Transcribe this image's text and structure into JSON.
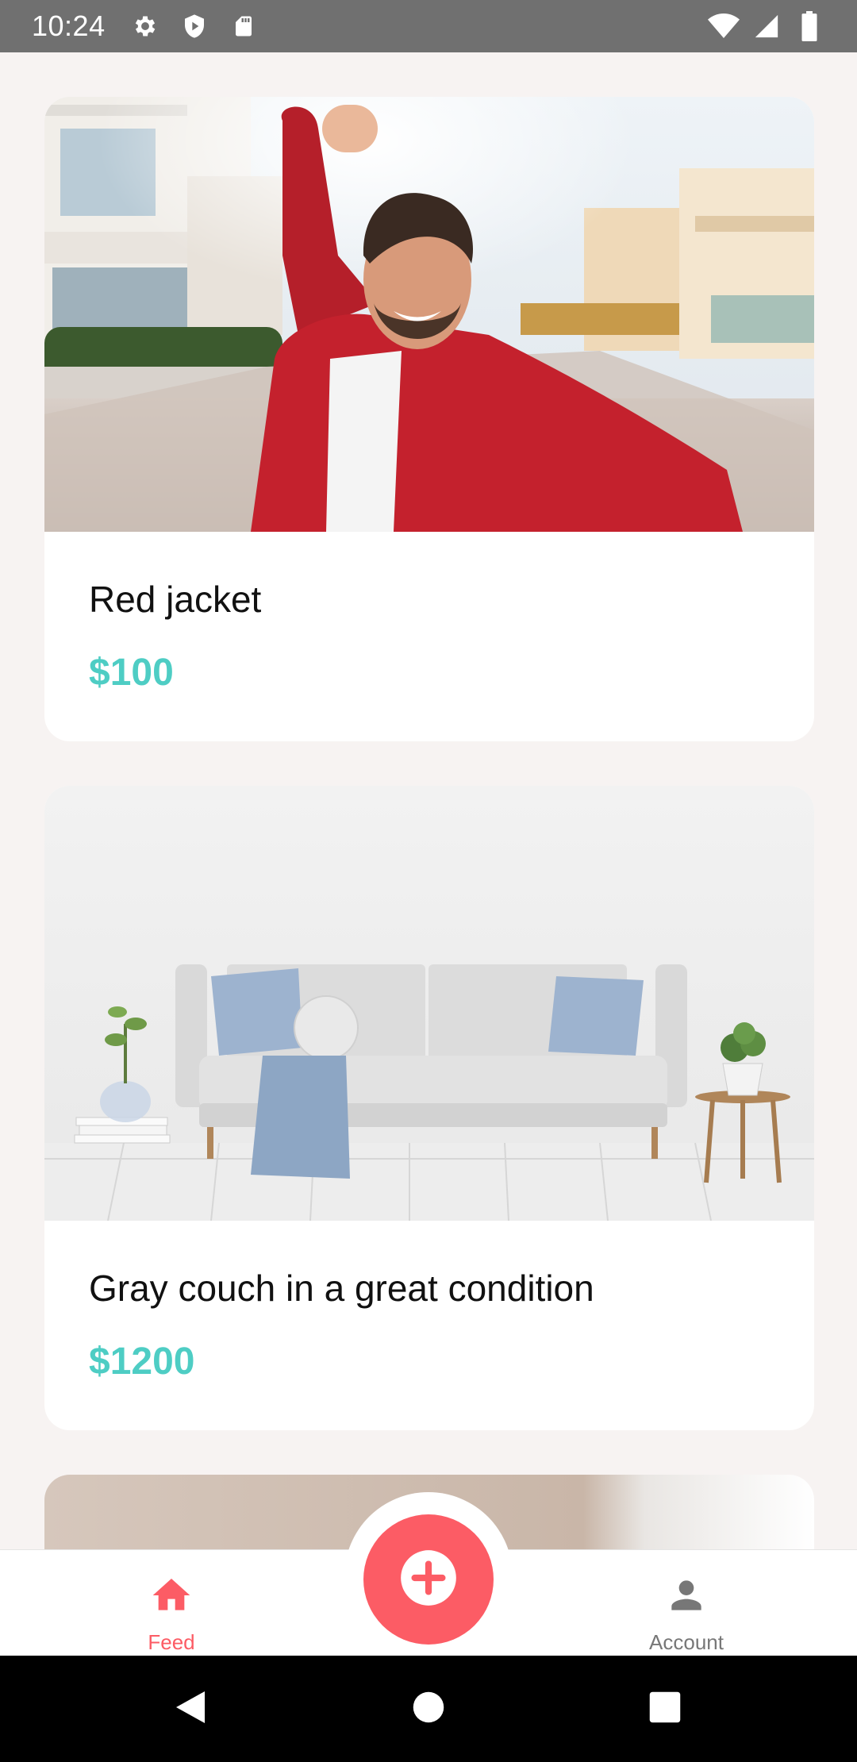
{
  "status_bar": {
    "time": "10:24",
    "left_icons": [
      "gear-icon",
      "shield-icon",
      "sd-card-icon"
    ],
    "right_icons": [
      "wifi-icon",
      "signal-icon",
      "battery-icon"
    ]
  },
  "feed": {
    "listings": [
      {
        "title": "Red jacket",
        "price": "$100",
        "image": "man-red-jacket-selfie-photo"
      },
      {
        "title": "Gray couch in a great condition",
        "price": "$1200",
        "image": "gray-couch-living-room-photo"
      }
    ]
  },
  "bottom_nav": {
    "feed_label": "Feed",
    "account_label": "Account",
    "active": "Feed"
  },
  "colors": {
    "primary": "#fc5c65",
    "secondary": "#4ecdc4",
    "background": "#f7f3f2",
    "inactive": "#777777"
  }
}
